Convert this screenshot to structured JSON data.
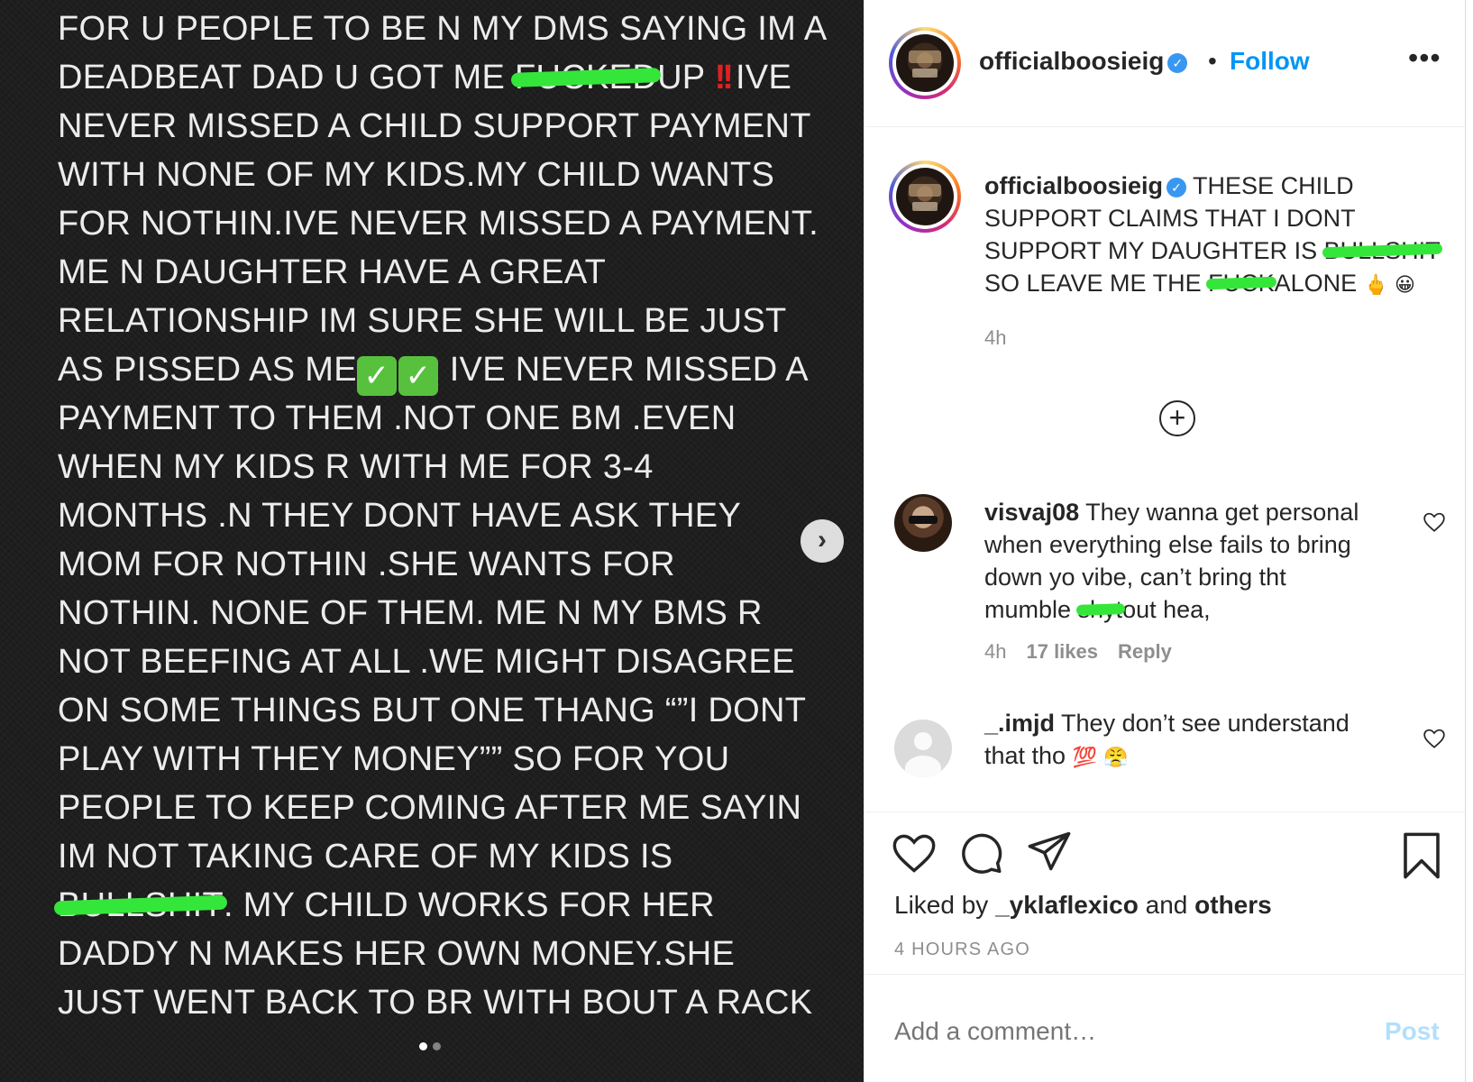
{
  "post_image": {
    "lines": [
      {
        "pre": "FOR U PEOPLE TO BE N MY DMS SAYING IM A"
      },
      {
        "pre": "DEADBEAT DAD U GOT ME ",
        "scribble": "FUCKED",
        "post": "UP ",
        "excl": "!!",
        "post2": "IVE"
      },
      {
        "pre": "NEVER MISSED A CHILD SUPPORT PAYMENT"
      },
      {
        "pre": "WITH NONE OF MY KIDS.MY CHILD WANTS"
      },
      {
        "pre": "FOR NOTHIN.IVE NEVER MISSED A PAYMENT."
      },
      {
        "pre": "ME N DAUGHTER HAVE A GREAT"
      },
      {
        "pre": "RELATIONSHIP IM SURE SHE WILL BE JUST"
      },
      {
        "pre": "AS PISSED AS ME",
        "checks": "✓",
        "post": " IVE NEVER MISSED A"
      },
      {
        "pre": "PAYMENT TO THEM .NOT ONE BM .EVEN"
      },
      {
        "pre": "WHEN MY KIDS R WITH ME FOR 3-4"
      },
      {
        "pre": "MONTHS .N THEY  DONT HAVE ASK THEY"
      },
      {
        "pre": "MOM FOR NOTHIN .SHE WANTS FOR"
      },
      {
        "pre": "NOTHIN. NONE OF THEM. ME N MY BMS R"
      },
      {
        "pre": "NOT BEEFING AT ALL .WE MIGHT DISAGREE"
      },
      {
        "pre": "ON SOME THINGS BUT ONE THANG “”I DONT"
      },
      {
        "pre": "PLAY WITH THEY MONEY”” SO FOR YOU"
      },
      {
        "pre": "PEOPLE TO KEEP COMING AFTER ME SAYIN"
      },
      {
        "pre": "IM NOT TAKING CARE OF MY KIDS IS"
      },
      {
        "pre": "",
        "scribble": "BULLSHIT",
        "post": ". MY CHILD WORKS FOR HER"
      },
      {
        "pre": "DADDY N MAKES HER OWN MONEY.SHE"
      },
      {
        "pre": "JUST WENT BACK TO BR WITH BOUT A RACK"
      }
    ],
    "next_arrow": "›"
  },
  "header": {
    "username": "officialboosieig",
    "separator": "•",
    "follow_label": "Follow",
    "more_label": "•••",
    "verified_mark": "✓"
  },
  "caption": {
    "username": "officialboosieig",
    "line1": "THESE CHILD",
    "line2": "SUPPORT CLAIMS THAT I DONT",
    "line3_pre": "SUPPORT MY DAUGHTER IS ",
    "line3_scribble": "BULLSHIT",
    "line4_pre": "SO LEAVE ME THE ",
    "line4_scribble": "FUCK",
    "line4_post": "ALONE",
    "emojis": "🖕 😀",
    "time": "4h"
  },
  "comments": [
    {
      "username": "visvaj08",
      "line1": "They wanna get personal",
      "line2": "when everything else fails to bring",
      "line3": "down yo vibe, can’t bring tht",
      "line4_pre": "mumble ",
      "line4_scribble": "shyt",
      "line4_post": "out hea,",
      "time": "4h",
      "likes": "17 likes",
      "reply": "Reply"
    },
    {
      "username": "_.imjd",
      "line1": "They don’t see understand",
      "line2": "that tho",
      "emojis": "💯 😤"
    }
  ],
  "liked_by": {
    "prefix": "Liked by ",
    "user": "_yklaflexico",
    "middle": " and ",
    "others": "others"
  },
  "post_date": "4 HOURS AGO",
  "add_comment": {
    "placeholder": "Add a comment…",
    "post_label": "Post"
  },
  "colors": {
    "accent_blue": "#0095f6",
    "verified_blue": "#3897f0",
    "scribble_green": "#35e63a",
    "image_bg": "#1e1e1f"
  }
}
